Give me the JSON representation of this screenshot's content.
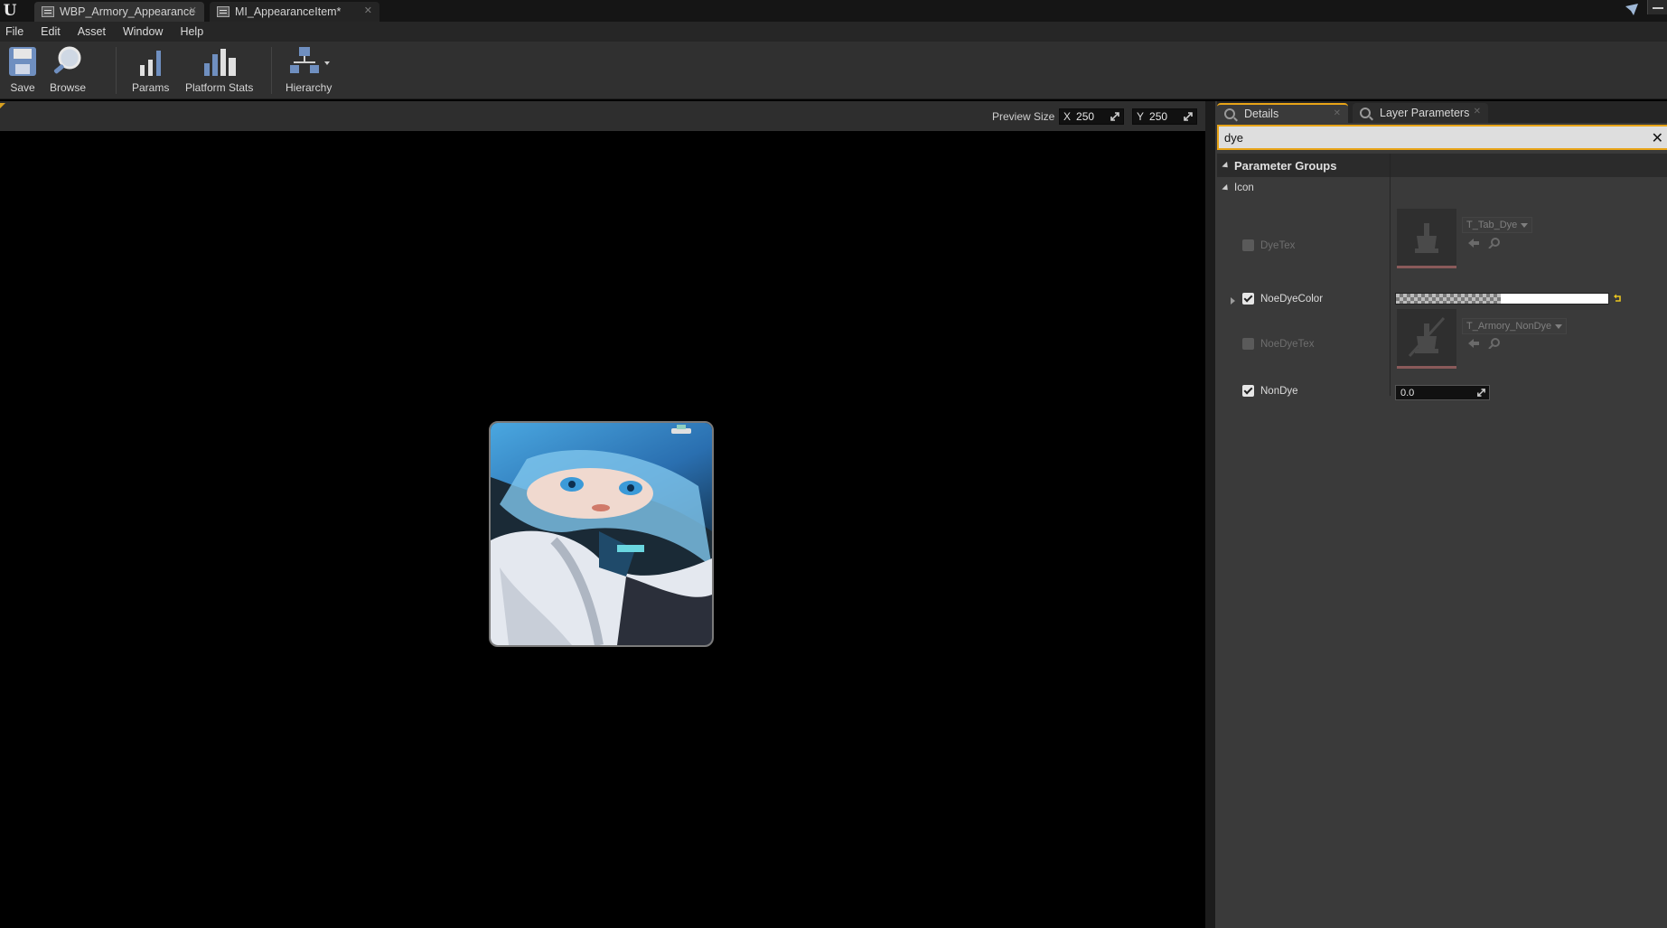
{
  "tabs": [
    {
      "label": "WBP_Armory_Appearance",
      "active": true
    },
    {
      "label": "MI_AppearanceItem*",
      "active": false
    }
  ],
  "menu": [
    "File",
    "Edit",
    "Asset",
    "Window",
    "Help"
  ],
  "toolbar": {
    "save": "Save",
    "browse": "Browse",
    "params": "Params",
    "platform_stats": "Platform Stats",
    "hierarchy": "Hierarchy"
  },
  "viewport": {
    "preview_size_label": "Preview Size",
    "x_axis": "X",
    "x_value": "250",
    "y_axis": "Y",
    "y_value": "250"
  },
  "details": {
    "tabs": [
      "Details",
      "Layer Parameters"
    ],
    "search_value": "dye",
    "group_header": "Parameter Groups",
    "category": "Icon",
    "params": {
      "dyetex": {
        "label": "DyeTex",
        "enabled": false,
        "asset": "T_Tab_Dye"
      },
      "noedyecolor": {
        "label": "NoeDyeColor",
        "enabled": true
      },
      "noedyetex": {
        "label": "NoeDyeTex",
        "enabled": false,
        "asset": "T_Armory_NonDye"
      },
      "nondye": {
        "label": "NonDye",
        "enabled": true,
        "value": "0.0"
      }
    }
  },
  "colors": {
    "accent": "#e8a417",
    "panel_bg": "#3a3a3a",
    "viewport_bg": "#000000"
  }
}
